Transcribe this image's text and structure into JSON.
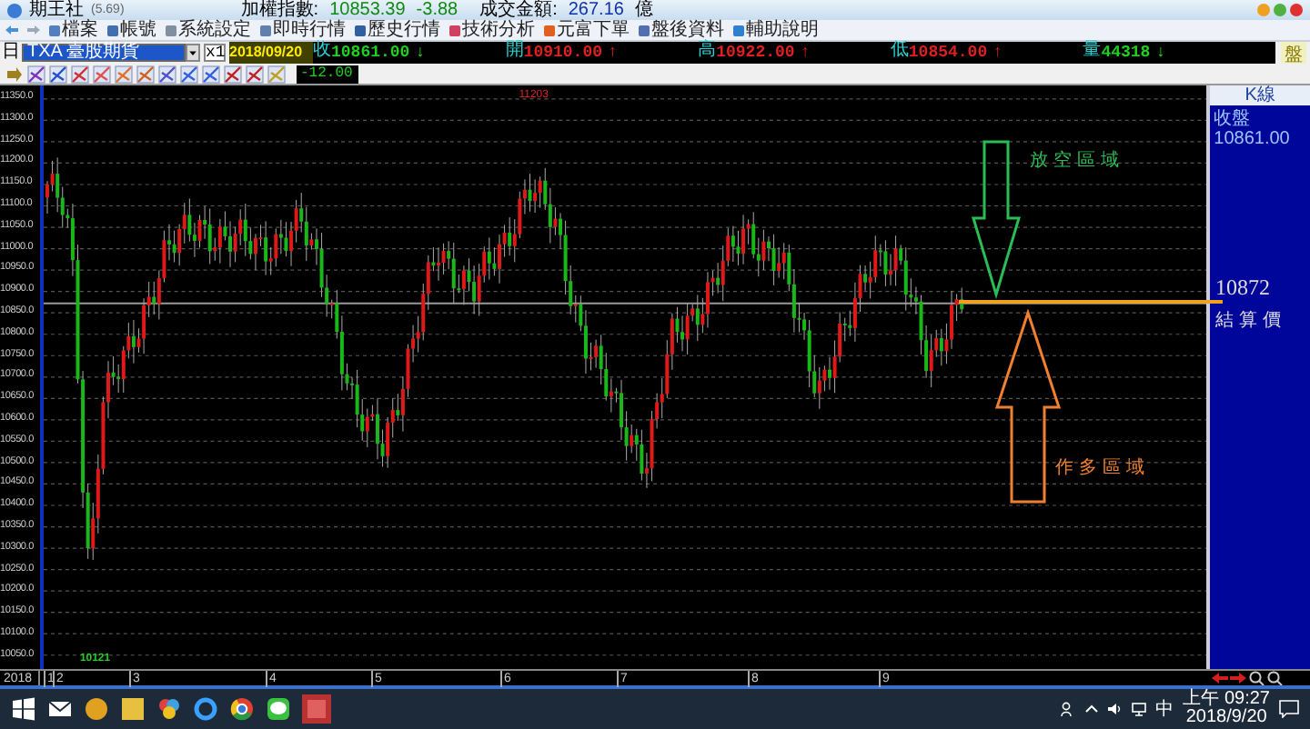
{
  "window": {
    "title": "期王社",
    "version": "(5.69)",
    "index_label": "加權指數:",
    "index_value": "10853.39",
    "index_change": "-3.88",
    "turnover_label": "成交金額:",
    "turnover_value": "267.16",
    "turnover_unit": "億"
  },
  "menu": [
    "檔案",
    "帳號",
    "系統設定",
    "即時行情",
    "歷史行情",
    "技術分析",
    "元富下單",
    "盤後資料",
    "輔助說明"
  ],
  "quote_bar": {
    "period": "日",
    "symbol": "TXA   臺股期貨",
    "multiplier": "x1",
    "date": "2018/09/20",
    "mode_button": "盤",
    "fields": [
      {
        "label": "收",
        "value": "10861.00",
        "arrow": "↓",
        "rising": false
      },
      {
        "label": "開",
        "value": "10910.00",
        "arrow": "↑",
        "rising": true
      },
      {
        "label": "高",
        "value": "10922.00",
        "arrow": "↑",
        "rising": true
      },
      {
        "label": "低",
        "value": "10854.00",
        "arrow": "↑",
        "rising": true
      },
      {
        "label": "量",
        "value": "44318",
        "arrow": "↓",
        "rising": false
      }
    ]
  },
  "tool_value": "-12.00",
  "chart": {
    "price_labels": [
      "11350.0",
      "11300.0",
      "11250.0",
      "11200.0",
      "11150.0",
      "11100.0",
      "11050.0",
      "11000.0",
      "10950.0",
      "10900.0",
      "10850.0",
      "10800.0",
      "10750.0",
      "10700.0",
      "10650.0",
      "10600.0",
      "10550.0",
      "10500.0",
      "10450.0",
      "10400.0",
      "10350.0",
      "10300.0",
      "10250.0",
      "10200.0",
      "10150.0",
      "10100.0",
      "10050.0"
    ],
    "high_label": "11203",
    "low_label": "10121",
    "year": "2018",
    "months": [
      "1",
      "2",
      "3",
      "4",
      "5",
      "6",
      "7",
      "8",
      "9"
    ],
    "side_panel": {
      "title": "K線",
      "caption": "收盤 10861.00"
    }
  },
  "annotations": {
    "short_zone": "放空區域",
    "long_zone": "作多區域",
    "settlement_value": "10872",
    "settlement_label": "結算價"
  },
  "taskbar": {
    "input_mode": "中",
    "time": "上午 09:27",
    "date": "2018/9/20"
  }
}
